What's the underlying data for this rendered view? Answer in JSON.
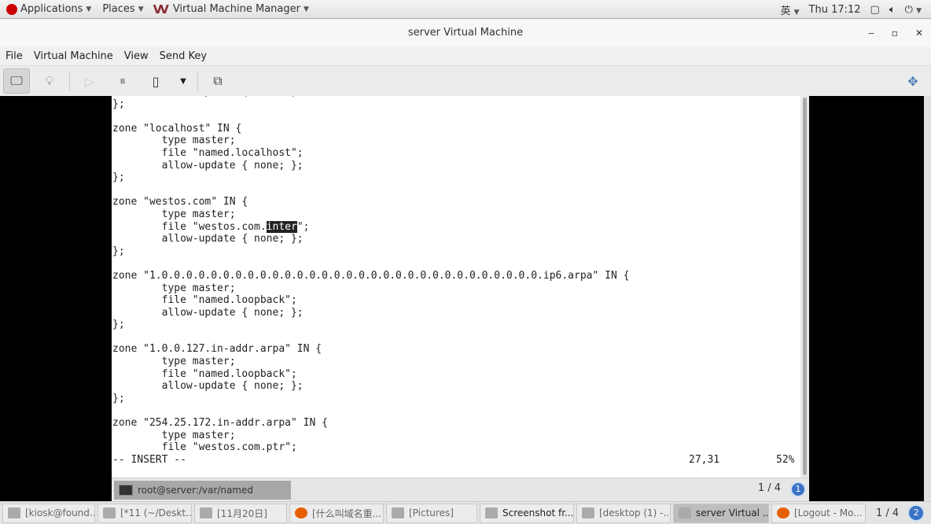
{
  "topbar": {
    "applications": "Applications",
    "places": "Places",
    "app_menu": "Virtual Machine Manager",
    "input_method": "英",
    "clock": "Thu 17:12"
  },
  "window": {
    "title": "server Virtual Machine",
    "minimize": "‒",
    "maximize": "▫",
    "close": "✕"
  },
  "menu": [
    "File",
    "Virtual Machine",
    "View",
    "Send Key"
  ],
  "editor": {
    "lines": [
      "        allow-update { none; };",
      "};",
      "",
      "zone \"localhost\" IN {",
      "        type master;",
      "        file \"named.localhost\";",
      "        allow-update { none; };",
      "};",
      "",
      "zone \"westos.com\" IN {",
      "        type master;",
      null,
      "        allow-update { none; };",
      "};",
      "",
      "zone \"1.0.0.0.0.0.0.0.0.0.0.0.0.0.0.0.0.0.0.0.0.0.0.0.0.0.0.0.0.0.0.0.ip6.arpa\" IN {",
      "        type master;",
      "        file \"named.loopback\";",
      "        allow-update { none; };",
      "};",
      "",
      "zone \"1.0.0.127.in-addr.arpa\" IN {",
      "        type master;",
      "        file \"named.loopback\";",
      "        allow-update { none; };",
      "};",
      "",
      "zone \"254.25.172.in-addr.arpa\" IN {",
      "        type master;",
      "        file \"westos.com.ptr\";"
    ],
    "highlight_line": {
      "before": "        file \"westos.com.",
      "selected": "inter",
      "after": "\";"
    },
    "mode": "-- INSERT --",
    "position": "27,31",
    "percent": "52%"
  },
  "guest_panel": {
    "task": "root@server:/var/named",
    "pager": "1 / 4",
    "workspace": "1"
  },
  "taskbar": {
    "items": [
      "[kiosk@found...",
      "[*11 (~/Deskt...",
      "[11月20日]",
      "[什么叫域名重...",
      "[Pictures]",
      "Screenshot fr...",
      "[desktop (1) -...",
      "server Virtual ...",
      "[Logout - Mo..."
    ],
    "pager": "1 / 4",
    "workspace": "2"
  }
}
